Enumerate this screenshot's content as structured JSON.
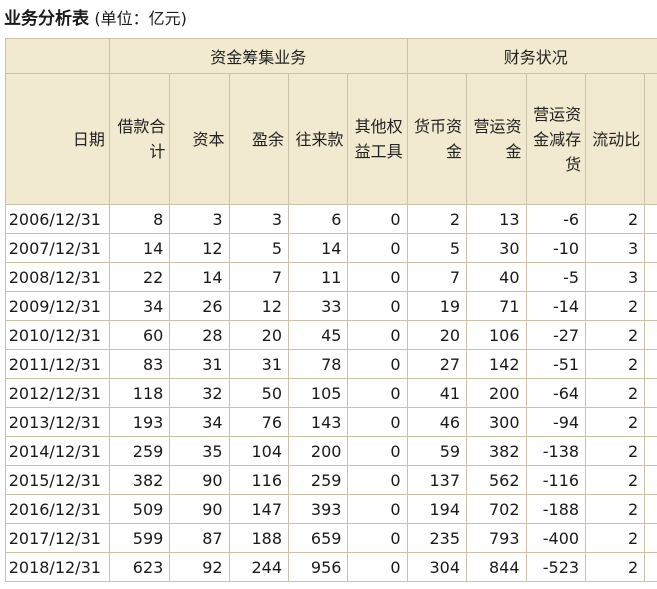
{
  "title": "业务分析表",
  "unit": "(单位：亿元)",
  "group_headers": [
    "资金筹集业务",
    "财务状况"
  ],
  "columns": [
    "日期",
    "借款合计",
    "资本",
    "盈余",
    "往来款",
    "其他权益工具",
    "货币资金",
    "营运资金",
    "营运资金减存货",
    "流动比"
  ],
  "rows": [
    [
      "2006/12/31",
      "8",
      "3",
      "3",
      "6",
      "0",
      "2",
      "13",
      "-6",
      "2"
    ],
    [
      "2007/12/31",
      "14",
      "12",
      "5",
      "14",
      "0",
      "5",
      "30",
      "-10",
      "3"
    ],
    [
      "2008/12/31",
      "22",
      "14",
      "7",
      "11",
      "0",
      "7",
      "40",
      "-5",
      "3"
    ],
    [
      "2009/12/31",
      "34",
      "26",
      "12",
      "33",
      "0",
      "19",
      "71",
      "-14",
      "2"
    ],
    [
      "2010/12/31",
      "60",
      "28",
      "20",
      "45",
      "0",
      "20",
      "106",
      "-27",
      "2"
    ],
    [
      "2011/12/31",
      "83",
      "31",
      "31",
      "78",
      "0",
      "27",
      "142",
      "-51",
      "2"
    ],
    [
      "2012/12/31",
      "118",
      "32",
      "50",
      "105",
      "0",
      "41",
      "200",
      "-64",
      "2"
    ],
    [
      "2013/12/31",
      "193",
      "34",
      "76",
      "143",
      "0",
      "46",
      "300",
      "-94",
      "2"
    ],
    [
      "2014/12/31",
      "259",
      "35",
      "104",
      "200",
      "0",
      "59",
      "382",
      "-138",
      "2"
    ],
    [
      "2015/12/31",
      "382",
      "90",
      "116",
      "259",
      "0",
      "137",
      "562",
      "-116",
      "2"
    ],
    [
      "2016/12/31",
      "509",
      "90",
      "147",
      "393",
      "0",
      "194",
      "702",
      "-188",
      "2"
    ],
    [
      "2017/12/31",
      "599",
      "87",
      "188",
      "659",
      "0",
      "235",
      "793",
      "-400",
      "2"
    ],
    [
      "2018/12/31",
      "623",
      "92",
      "244",
      "956",
      "0",
      "304",
      "844",
      "-523",
      "2"
    ]
  ],
  "colors": {
    "header_bg": "#f1ead0",
    "border": "#c8c2a8"
  }
}
